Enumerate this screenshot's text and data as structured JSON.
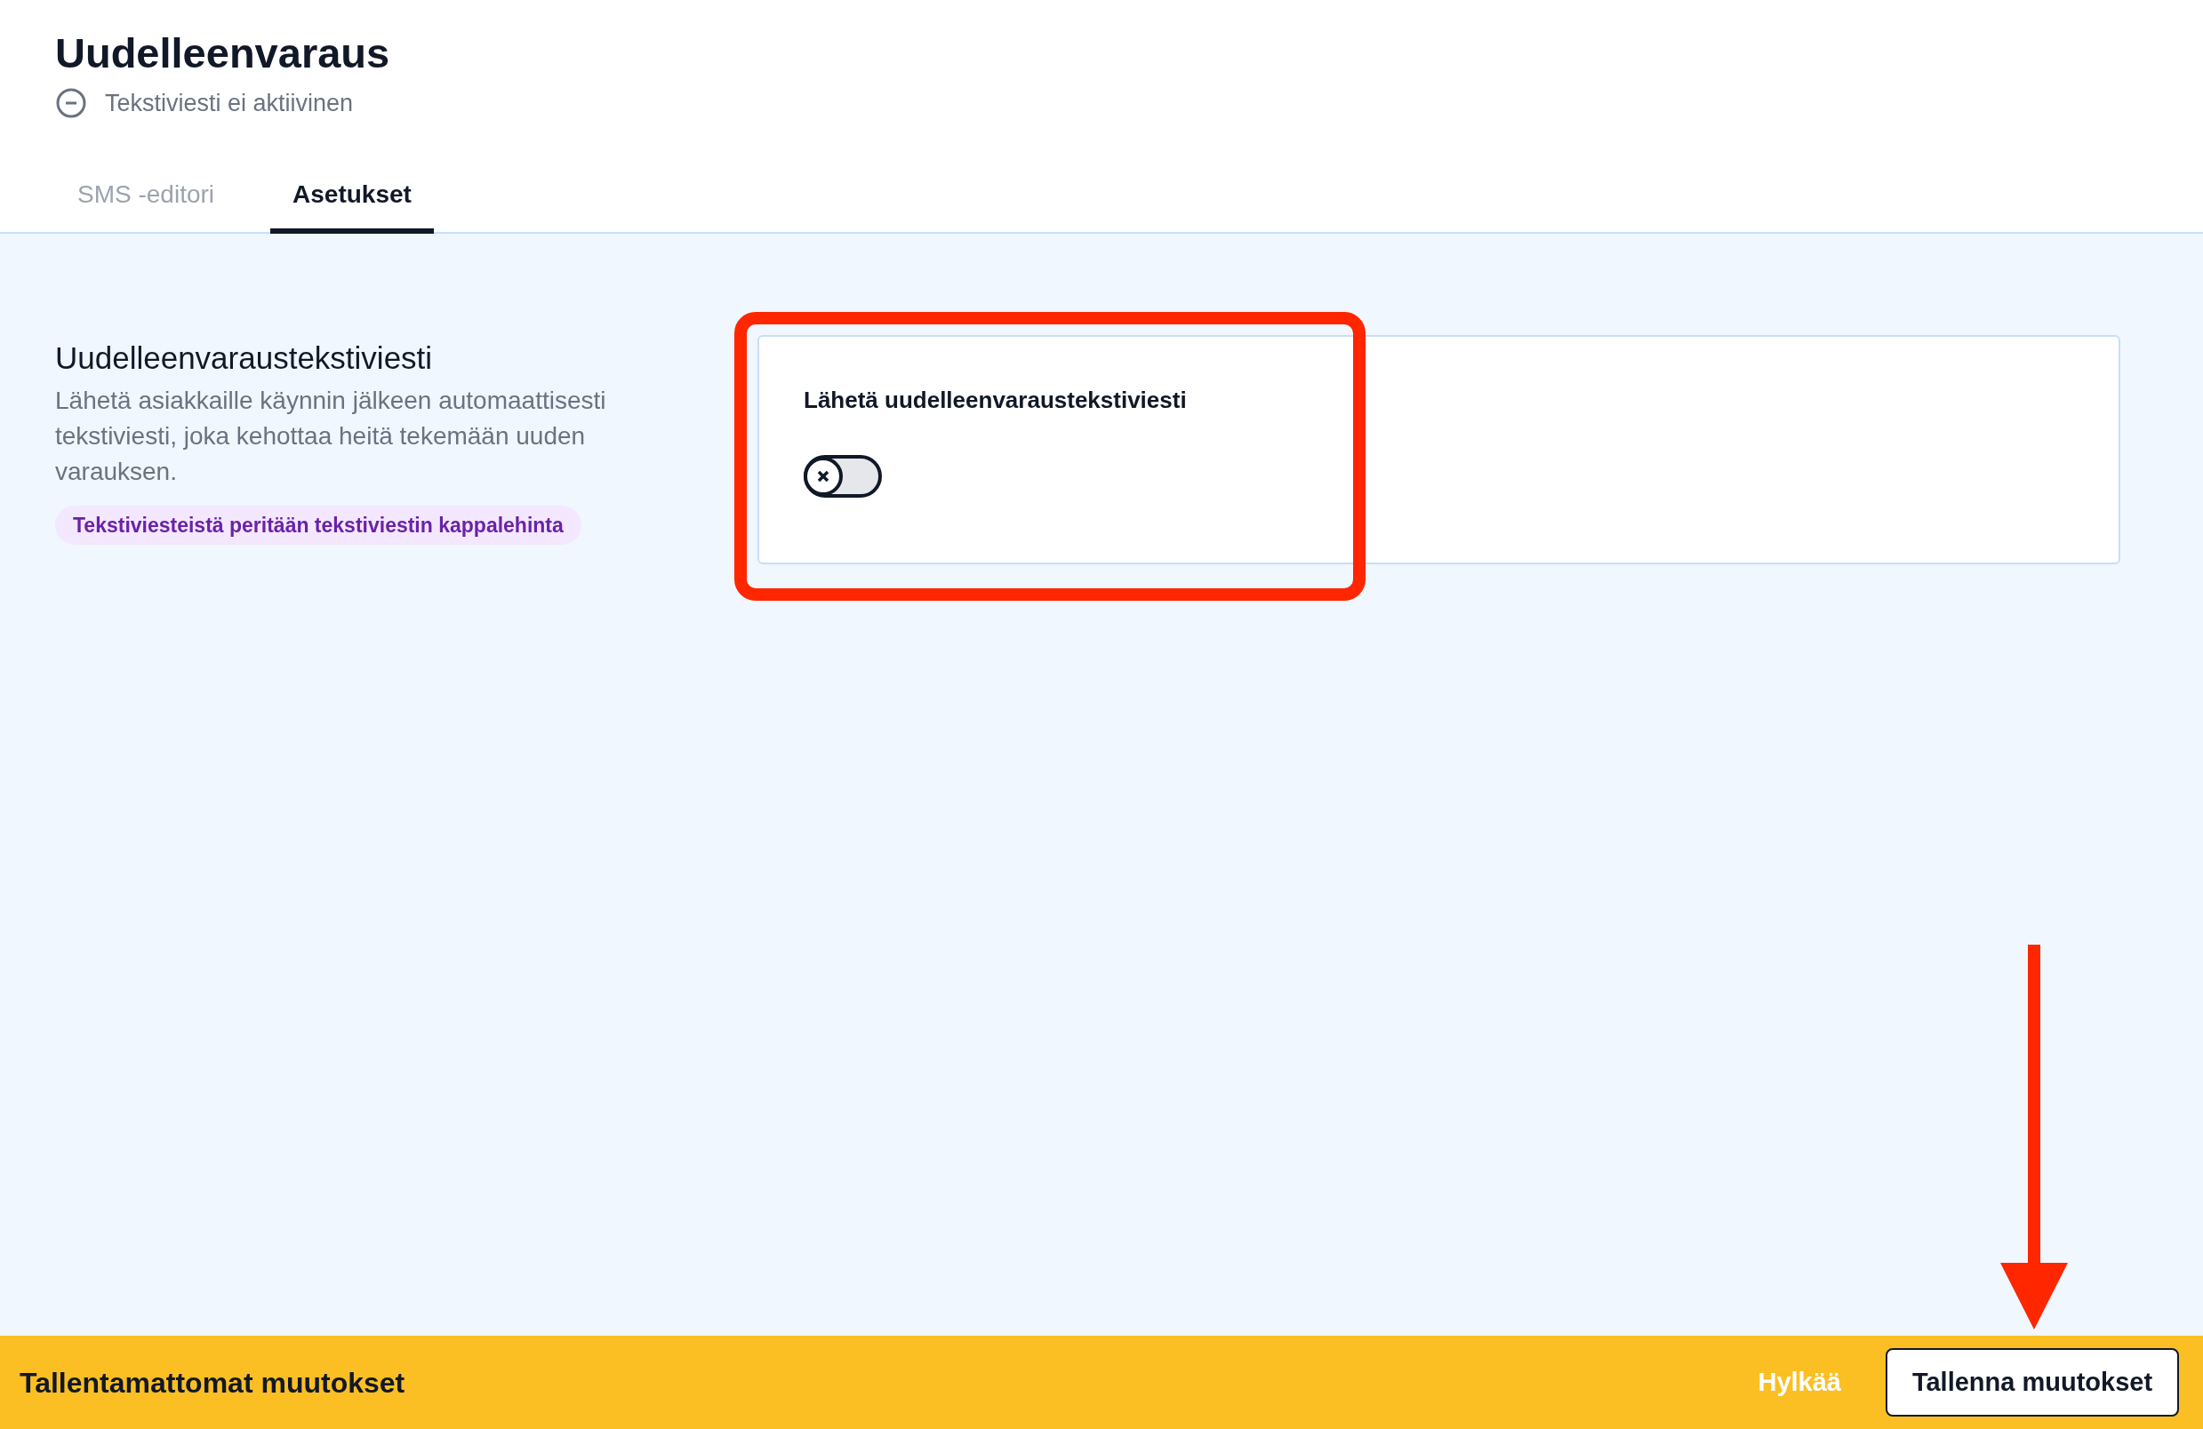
{
  "header": {
    "title": "Uudelleenvaraus",
    "status": {
      "text": "Tekstiviesti ei aktiivinen",
      "active": false
    }
  },
  "tabs": [
    {
      "label": "SMS -editori",
      "selected": false
    },
    {
      "label": "Asetukset",
      "selected": true
    }
  ],
  "section": {
    "heading": "Uudelleenvaraustekstiviesti",
    "description": "Lähetä asiakkaille käynnin jälkeen automaattisesti tekstiviesti, joka kehottaa heitä tekemään uuden varauksen.",
    "badge": "Tekstiviesteistä peritään tekstiviestin kappalehinta"
  },
  "setting": {
    "label": "Lähetä uudelleenvaraustekstiviesti",
    "on": false
  },
  "unsaved_bar": {
    "message": "Tallentamattomat muutokset",
    "discard": "Hylkää",
    "save": "Tallenna muutokset"
  }
}
